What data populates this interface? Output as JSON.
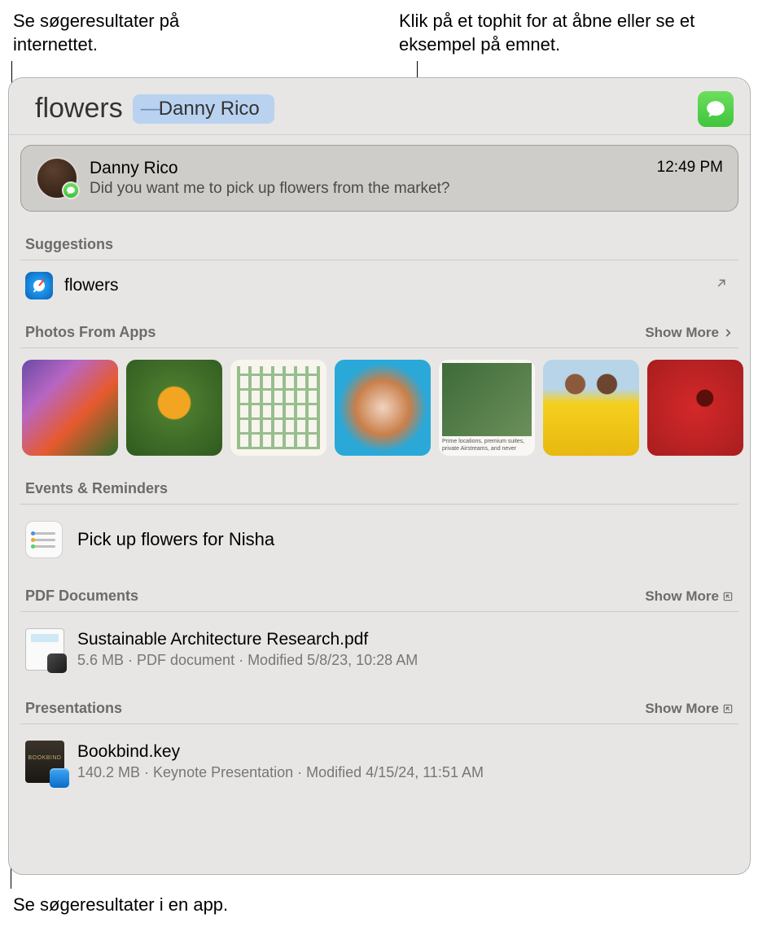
{
  "callouts": {
    "top_left": "Se søgeresultater på internettet.",
    "top_right": "Klik på et tophit for at åbne eller se et eksempel på emnet.",
    "bottom_left": "Se søgeresultater i en app."
  },
  "search": {
    "term": "flowers",
    "token": "Danny Rico",
    "app_badge": "messages-icon"
  },
  "top_hit": {
    "name": "Danny Rico",
    "message": "Did you want me to pick up flowers from the market?",
    "time": "12:49 PM"
  },
  "sections": {
    "suggestions": {
      "header": "Suggestions",
      "item": "flowers"
    },
    "photos": {
      "header": "Photos From Apps",
      "show_more": "Show More",
      "thumb5_text": "Prime locations, premium suites, private Airstreams, and never"
    },
    "events": {
      "header": "Events & Reminders",
      "item": "Pick up flowers for Nisha"
    },
    "pdfs": {
      "header": "PDF Documents",
      "show_more": "Show More",
      "file": {
        "name": "Sustainable Architecture Research.pdf",
        "meta": "5.6 MB · PDF document · Modified 5/8/23, 10:28 AM"
      }
    },
    "presentations": {
      "header": "Presentations",
      "show_more": "Show More",
      "file": {
        "name": "Bookbind.key",
        "meta": "140.2 MB · Keynote Presentation · Modified 4/15/24, 11:51 AM"
      }
    }
  }
}
